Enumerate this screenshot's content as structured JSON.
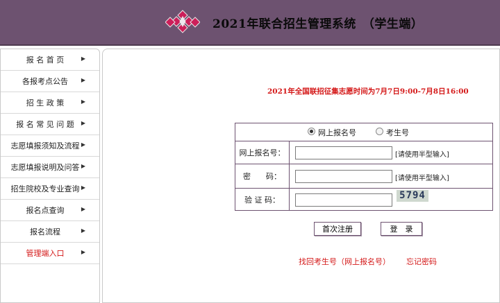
{
  "header": {
    "title": "2021年联合招生管理系统　（学生端）",
    "logo_icon": "diamond-cluster-logo",
    "background": "#6d5270",
    "logo_colors": [
      "#cc1f5a",
      "#e8e8e8"
    ]
  },
  "sidebar": {
    "items": [
      {
        "label": "报 名 首 页",
        "arrow": "▶"
      },
      {
        "label": "各报考点公告",
        "arrow": "▶"
      },
      {
        "label": "招 生 政 策",
        "arrow": "▶"
      },
      {
        "label": "报 名 常 见 问 题",
        "arrow": "▶"
      },
      {
        "label": "志愿填报须知及流程",
        "arrow": "▶"
      },
      {
        "label": "志愿填报说明及问答",
        "arrow": "▶"
      },
      {
        "label": "招生院校及专业查询",
        "arrow": "▶"
      },
      {
        "label": "报名点查询",
        "arrow": "▶"
      },
      {
        "label": "报名流程",
        "arrow": "▶"
      },
      {
        "label": "管理端入口",
        "arrow": "▶"
      }
    ]
  },
  "notice": "2021年全国联招征集志愿时间为7月7日9:00-7月8日16:00",
  "login": {
    "radio_options": [
      {
        "label": "网上报名号",
        "checked": true
      },
      {
        "label": "考生号",
        "checked": false
      }
    ],
    "fields": {
      "reg_no_label": "网上报名号：",
      "reg_no_value": "",
      "reg_no_hint": "[请使用半型输入]",
      "password_label": "密　　码：",
      "password_value": "",
      "password_hint": "[请使用半型输入]",
      "captcha_label": "验 证 码：",
      "captcha_value": "",
      "captcha_image_text": "5794"
    },
    "first_register_button": "首次注册",
    "login_button": "登　录"
  },
  "links": {
    "find_id": "找回考生号（网上报名号）",
    "forgot_password": "忘记密码"
  },
  "colors": {
    "accent": "#6d5270",
    "link_red": "#d41818"
  }
}
